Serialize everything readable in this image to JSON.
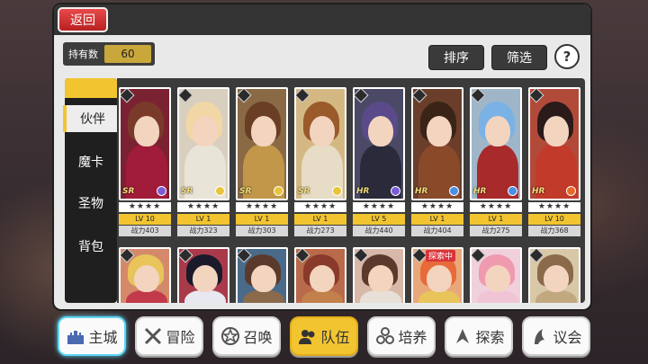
{
  "header": {
    "back_label": "返回"
  },
  "owned": {
    "label": "持有数",
    "value": "60"
  },
  "toolbar": {
    "sort_label": "排序",
    "filter_label": "筛选",
    "help_label": "?"
  },
  "sidebar": {
    "items": [
      {
        "label": "伙伴",
        "active": true
      },
      {
        "label": "魔卡",
        "active": false
      },
      {
        "label": "圣物",
        "active": false
      },
      {
        "label": "背包",
        "active": false
      }
    ]
  },
  "cards_row1": [
    {
      "rarity": "SR",
      "stars": "★★★★",
      "level": "LV 10",
      "power": "战力403",
      "hair": "#7a3a2a",
      "outfit": "#a01c3a",
      "bg": "#7b2232",
      "elem": "#7a5cd6"
    },
    {
      "rarity": "SR",
      "stars": "★★★★",
      "level": "LV 1",
      "power": "战力323",
      "hair": "#f1d7a6",
      "outfit": "#e9e4d8",
      "bg": "#d9cfbf",
      "elem": "#e8c43a"
    },
    {
      "rarity": "SR",
      "stars": "★★★★",
      "level": "LV 1",
      "power": "战力303",
      "hair": "#6a3e25",
      "outfit": "#c2974a",
      "bg": "#8a6a45",
      "elem": "#e8c43a"
    },
    {
      "rarity": "SR",
      "stars": "★★★★",
      "level": "LV 1",
      "power": "战力273",
      "hair": "#9a5a2a",
      "outfit": "#e7dcc6",
      "bg": "#d4b884",
      "elem": "#e8c43a"
    },
    {
      "rarity": "HR",
      "stars": "★★★★",
      "level": "LV 5",
      "power": "战力440",
      "hair": "#5a4a8a",
      "outfit": "#2a2a3a",
      "bg": "#4a4a66",
      "elem": "#7a5cd6"
    },
    {
      "rarity": "HR",
      "stars": "★★★★",
      "level": "LV 1",
      "power": "战力404",
      "hair": "#3a2418",
      "outfit": "#8a4a2a",
      "bg": "#6a3e2a",
      "elem": "#4a8ee6"
    },
    {
      "rarity": "HR",
      "stars": "★★★★",
      "level": "LV 1",
      "power": "战力275",
      "hair": "#7ab2e6",
      "outfit": "#a82a2a",
      "bg": "#9fb6c8",
      "elem": "#4a8ee6"
    },
    {
      "rarity": "HR",
      "stars": "★★★★",
      "level": "LV 10",
      "power": "战力368",
      "hair": "#2a1a1a",
      "outfit": "#c23a2a",
      "bg": "#b24a3a",
      "elem": "#e86a2a"
    }
  ],
  "cards_row2": [
    {
      "hair": "#e8c45a",
      "outfit": "#c23a4a",
      "bg": "#d48a6a",
      "tag": ""
    },
    {
      "hair": "#1a1a2a",
      "outfit": "#e8e8f0",
      "bg": "#a83a4a",
      "tag": ""
    },
    {
      "hair": "#5a3a2a",
      "outfit": "#8a6a4a",
      "bg": "#4a6a8a",
      "tag": ""
    },
    {
      "hair": "#8a3a2a",
      "outfit": "#c2804a",
      "bg": "#b86a4a",
      "tag": ""
    },
    {
      "hair": "#5a3a2a",
      "outfit": "#e8e0d8",
      "bg": "#d8b8a8",
      "tag": ""
    },
    {
      "hair": "#e86a3a",
      "outfit": "#e8c45a",
      "bg": "#e8a87a",
      "tag": "探索中"
    },
    {
      "hair": "#f09ab0",
      "outfit": "#f0c4d4",
      "bg": "#f0d0dc",
      "tag": ""
    },
    {
      "hair": "#8a6a4a",
      "outfit": "#c2a880",
      "bg": "#d8c8a8",
      "tag": ""
    }
  ],
  "nav": [
    {
      "label": "主城",
      "icon": "castle-icon",
      "state": "home"
    },
    {
      "label": "冒险",
      "icon": "crossed-swords-icon",
      "state": ""
    },
    {
      "label": "召唤",
      "icon": "summon-star-icon",
      "state": ""
    },
    {
      "label": "队伍",
      "icon": "team-icon",
      "state": "active"
    },
    {
      "label": "培养",
      "icon": "train-icon",
      "state": ""
    },
    {
      "label": "探索",
      "icon": "explore-icon",
      "state": ""
    },
    {
      "label": "议会",
      "icon": "council-icon",
      "state": ""
    }
  ]
}
